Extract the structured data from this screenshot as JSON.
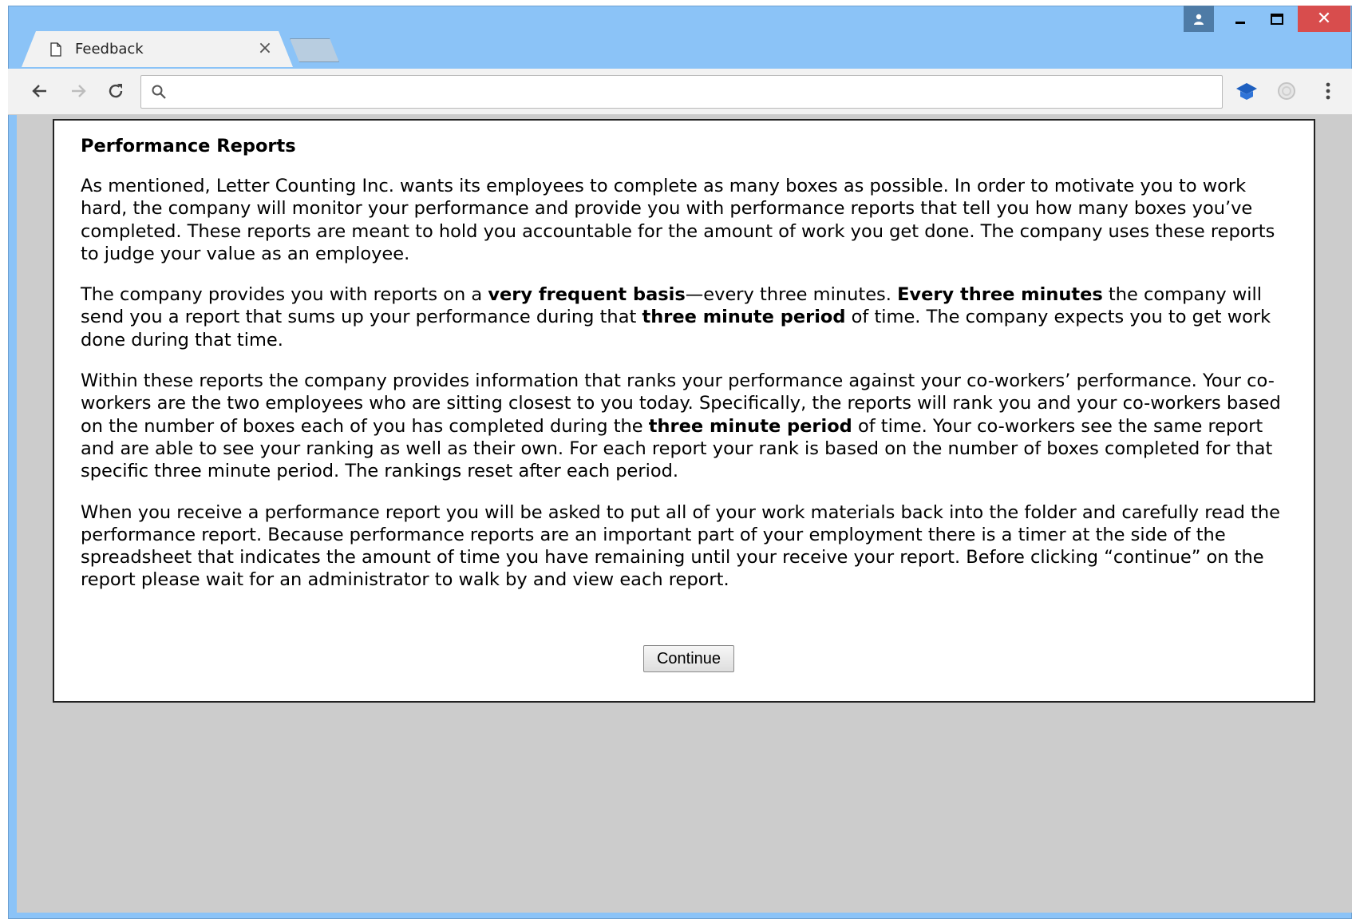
{
  "browser": {
    "tab_title": "Feedback",
    "tab_close": "×",
    "address_value": "",
    "window_close": "✕"
  },
  "icons": {
    "tab": "file-icon",
    "back": "arrow-left-icon",
    "forward": "arrow-right-icon",
    "reload": "reload-icon",
    "search": "search-icon",
    "extension1": "graduation-cap-icon",
    "extension2": "circle-icon",
    "menu": "kebab-menu-icon",
    "user": "user-icon",
    "minimize": "minimize-icon",
    "maximize": "maximize-icon",
    "close": "close-icon"
  },
  "page": {
    "title": "Performance Reports",
    "p1": "As mentioned, Letter Counting Inc. wants its employees to complete as many boxes as possible. In order to motivate you to work hard, the company will monitor your performance and provide you with performance reports that tell you how many boxes you’ve completed. These reports are meant to hold you accountable for the amount of work you get done. The company uses these reports to judge your value as an employee.",
    "p2": {
      "a": "The company provides you with reports on a ",
      "b": "very frequent basis",
      "c": "—every three minutes. ",
      "d": "Every three minutes",
      "e": " the company will send you a report that sums up your performance during that ",
      "f": "three minute period",
      "g": " of time. The company expects you to get work done during that time."
    },
    "p3": {
      "a": "Within these reports the company provides information that ranks your performance against your co-workers’ performance. Your co-workers are the two employees who are sitting closest to you today. Specifically, the reports will rank you and your co-workers based on the number of boxes each of you has completed during the ",
      "b": "three minute period",
      "c": " of time. Your co-workers see the same report and are able to see your ranking as well as their own. For each report your rank is based on the number of boxes completed for that specific three minute period. The rankings reset after each period."
    },
    "p4": "When you receive a performance report you will be asked to put all of your work materials back into the folder and carefully read the performance report. Because performance reports are an important part of your employment there is a timer at the side of the spreadsheet that indicates the amount of time you have remaining until your receive your report. Before clicking “continue” on the report please wait for an administrator to walk by and view each report.",
    "continue_label": "Continue"
  }
}
